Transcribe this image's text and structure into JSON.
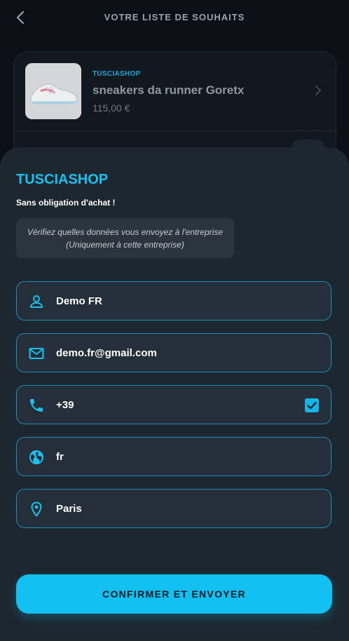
{
  "header": {
    "title": "VOTRE LISTE DE SOUHAITS"
  },
  "product": {
    "brand": "TUSCIASHOP",
    "name": "sneakers da runner Goretx",
    "price": "115,00 €"
  },
  "sheet": {
    "shop_name": "TUSCIASHOP",
    "subtitle": "Sans obligation d'achat !",
    "notice_line1": "Vérifiez quelles données vous envoyez à l'entreprise",
    "notice_line2": "(Uniquement à cette entreprise)"
  },
  "fields": {
    "name": {
      "value": "Demo FR",
      "icon": "person-icon"
    },
    "email": {
      "value": "demo.fr@gmail.com",
      "icon": "mail-icon"
    },
    "phone": {
      "value": "+39",
      "icon": "phone-icon",
      "checked": true
    },
    "language": {
      "value": "fr",
      "icon": "globe-icon"
    },
    "city": {
      "value": "Paris",
      "icon": "location-pin-icon"
    }
  },
  "actions": {
    "confirm_label": "CONFIRMER ET ENVOYER"
  },
  "colors": {
    "accent": "#11c0f0",
    "background": "#0b1016",
    "sheet": "#1d2730",
    "field_border": "#1e8cb8"
  }
}
